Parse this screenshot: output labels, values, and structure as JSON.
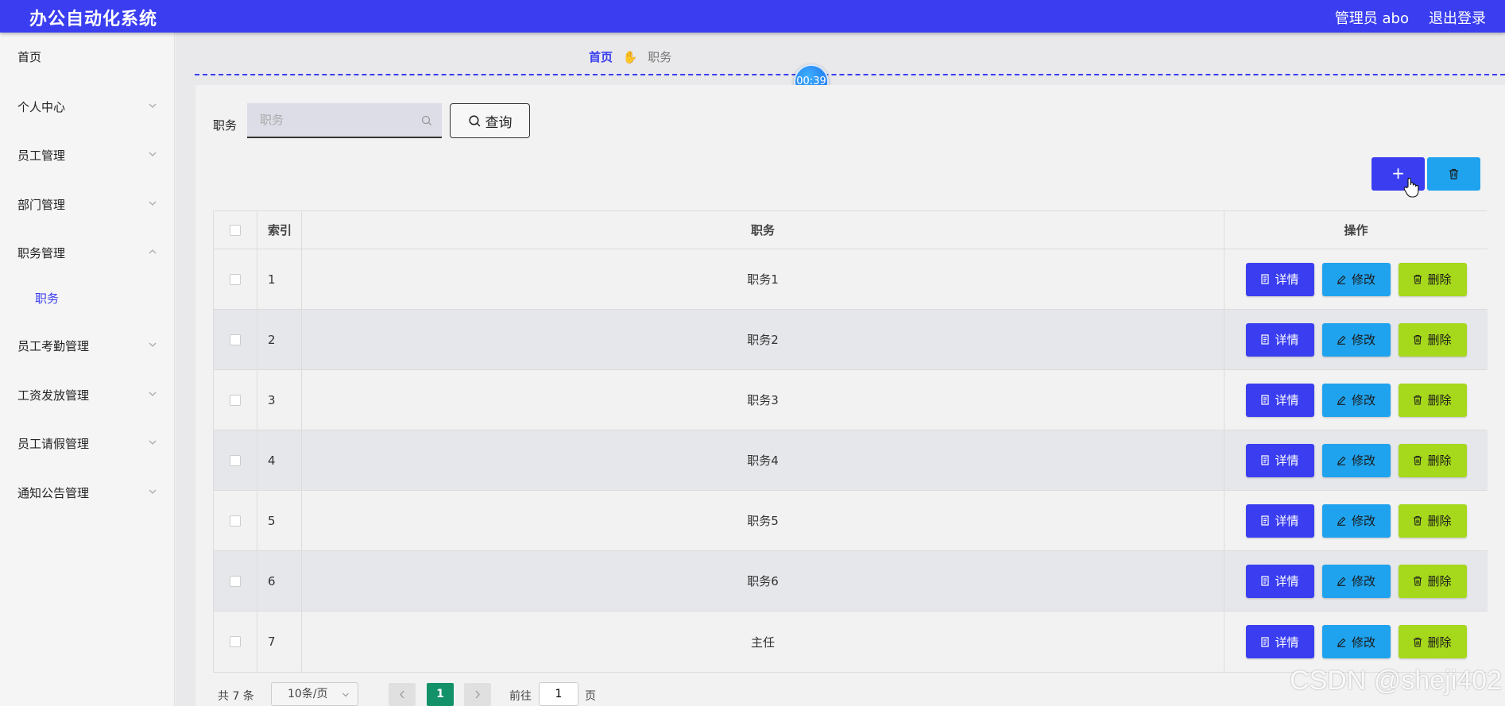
{
  "app": {
    "title": "办公自动化系统",
    "admin": "管理员 abo",
    "logout": "退出登录"
  },
  "sidebar": {
    "items": [
      {
        "label": "首页"
      },
      {
        "label": "个人中心"
      },
      {
        "label": "员工管理"
      },
      {
        "label": "部门管理"
      },
      {
        "label": "职务管理"
      },
      {
        "label": "员工考勤管理"
      },
      {
        "label": "工资发放管理"
      },
      {
        "label": "员工请假管理"
      },
      {
        "label": "通知公告管理"
      }
    ],
    "active_sub": "职务"
  },
  "breadcrumb": {
    "home": "首页",
    "current": "职务"
  },
  "timer": "00:39",
  "search": {
    "label": "职务",
    "placeholder": "职务",
    "value": "",
    "button": "查询"
  },
  "table": {
    "headers": {
      "index": "索引",
      "name": "职务",
      "ops": "操作"
    },
    "rows": [
      {
        "index": "1",
        "name": "职务1"
      },
      {
        "index": "2",
        "name": "职务2"
      },
      {
        "index": "3",
        "name": "职务3"
      },
      {
        "index": "4",
        "name": "职务4"
      },
      {
        "index": "5",
        "name": "职务5"
      },
      {
        "index": "6",
        "name": "职务6"
      },
      {
        "index": "7",
        "name": "主任"
      }
    ],
    "actions": {
      "detail": "详情",
      "edit": "修改",
      "delete": "删除"
    }
  },
  "pager": {
    "total": "共 7 条",
    "page_size": "10条/页",
    "current": "1",
    "goto": "前往",
    "goto_value": "1",
    "page_unit": "页"
  },
  "watermark": "CSDN @sheji402",
  "colors": {
    "primary": "#3a3ef0",
    "info": "#1fa3ee",
    "danger": "#a6d81b",
    "pager_active": "#139169"
  }
}
